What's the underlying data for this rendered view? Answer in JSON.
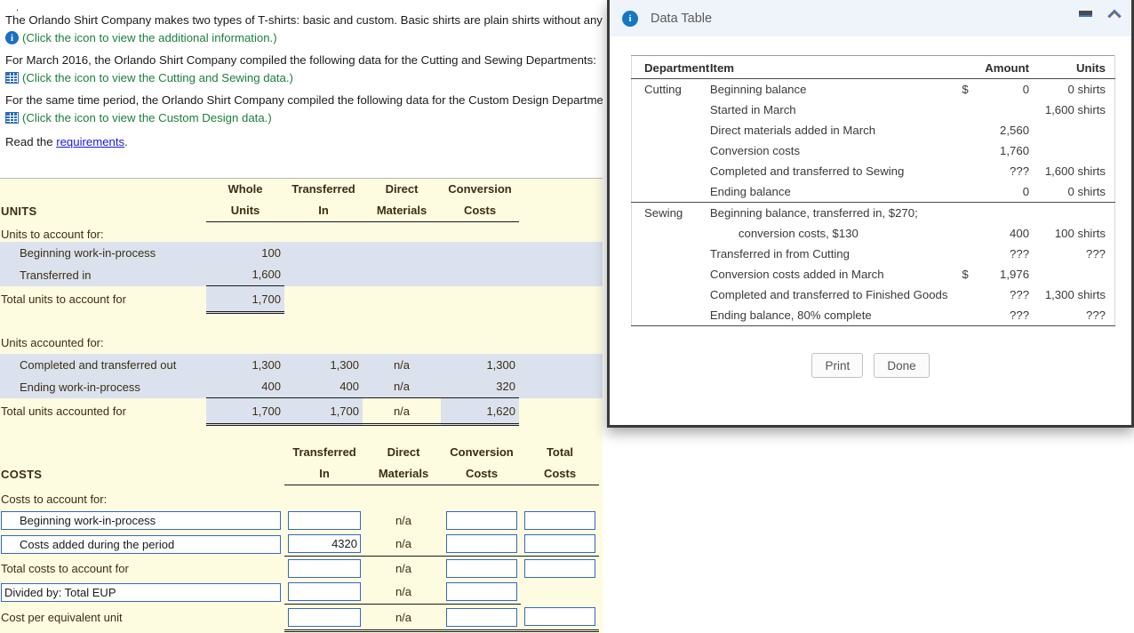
{
  "stray_char": ".",
  "prompt": {
    "intro": "The Orlando Shirt Company makes two types of T-shirts: basic and custom. Basic shirts are plain shirts without any",
    "info_caption": "(Click the icon to view the additional information.)",
    "line2": "For March 2016, the Orlando Shirt Company compiled the following data for the Cutting and Sewing Departments:",
    "line2_caption": "(Click the icon to view the Cutting and Sewing data.)",
    "line3": "For the same time period, the Orlando Shirt Company compiled the following data for the Custom Design Department",
    "line3_caption": "(Click the icon to view the Custom Design data.)",
    "read_prefix": "Read the ",
    "read_link": "requirements",
    "read_suffix": "."
  },
  "units_section": {
    "title": "UNITS",
    "headers": [
      {
        "top": "Whole",
        "bottom": "Units"
      },
      {
        "top": "Transferred",
        "bottom": "In"
      },
      {
        "top": "Direct",
        "bottom": "Materials"
      },
      {
        "top": "Conversion",
        "bottom": "Costs"
      }
    ],
    "to_account_header": "Units to account for:",
    "to_account_rows": [
      {
        "label": "Beginning work-in-process",
        "whole": "100",
        "transferred": "",
        "materials": "",
        "conversion": ""
      },
      {
        "label": "Transferred in",
        "whole": "1,600",
        "transferred": "",
        "materials": "",
        "conversion": ""
      }
    ],
    "to_account_total": {
      "label": "Total units to account for",
      "whole": "1,700",
      "transferred": "",
      "materials": "",
      "conversion": ""
    },
    "accounted_header": "Units accounted for:",
    "accounted_rows": [
      {
        "label": "Completed and transferred out",
        "whole": "1,300",
        "transferred": "1,300",
        "materials": "n/a",
        "conversion": "1,300"
      },
      {
        "label": "Ending work-in-process",
        "whole": "400",
        "transferred": "400",
        "materials": "n/a",
        "conversion": "320"
      }
    ],
    "accounted_total": {
      "label": "Total units accounted for",
      "whole": "1,700",
      "transferred": "1,700",
      "materials": "n/a",
      "conversion": "1,620"
    }
  },
  "costs_section": {
    "title": "COSTS",
    "headers": [
      {
        "top": "Transferred",
        "bottom": "In"
      },
      {
        "top": "Direct",
        "bottom": "Materials"
      },
      {
        "top": "Conversion",
        "bottom": "Costs"
      },
      {
        "top": "Total",
        "bottom": "Costs"
      }
    ],
    "to_account_header": "Costs to account for:",
    "rows": [
      {
        "label": "Beginning work-in-process",
        "label_boxed": true,
        "transferred": "",
        "materials": "n/a",
        "conversion": "",
        "total": ""
      },
      {
        "label": "Costs added during the period",
        "label_boxed": true,
        "transferred": "4320",
        "materials": "n/a",
        "conversion": "",
        "total": ""
      },
      {
        "label": "Total costs to account for",
        "label_boxed": false,
        "transferred": "",
        "materials": "n/a",
        "conversion": "",
        "total": ""
      },
      {
        "label": "Divided by: Total EUP",
        "label_boxed": true,
        "transferred": "",
        "materials": "n/a",
        "conversion": "",
        "total": null
      },
      {
        "label": "Cost per equivalent unit",
        "label_boxed": false,
        "transferred": "",
        "materials": "n/a",
        "conversion": "",
        "total": ""
      }
    ]
  },
  "dialog": {
    "badge": "i",
    "title": "Data Table",
    "minimize_icon": "minimize-icon",
    "expand_icon": "chevron-up-icon",
    "table": {
      "columns": [
        "Department",
        "Item",
        "Amount",
        "Units"
      ],
      "rows": [
        {
          "dept": "Cutting",
          "item": "Beginning balance",
          "currency": "$",
          "amount": "0",
          "units": "0 shirts"
        },
        {
          "dept": "",
          "item": "Started in March",
          "currency": "",
          "amount": "",
          "units": "1,600 shirts"
        },
        {
          "dept": "",
          "item": "Direct materials added in March",
          "currency": "",
          "amount": "2,560",
          "units": ""
        },
        {
          "dept": "",
          "item": "Conversion costs",
          "currency": "",
          "amount": "1,760",
          "units": ""
        },
        {
          "dept": "",
          "item": "Completed and transferred to Sewing",
          "currency": "",
          "amount": "???",
          "units": "1,600 shirts"
        },
        {
          "dept": "",
          "item": "Ending balance",
          "currency": "",
          "amount": "0",
          "units": "0 shirts"
        },
        {
          "dept": "Sewing",
          "item": "Beginning balance, transferred in, $270;",
          "currency": "",
          "amount": "",
          "units": ""
        },
        {
          "dept": "",
          "item": "conversion costs, $130",
          "indent": true,
          "currency": "",
          "amount": "400",
          "units": "100 shirts"
        },
        {
          "dept": "",
          "item": "Transferred in from Cutting",
          "currency": "",
          "amount": "???",
          "units": "???"
        },
        {
          "dept": "",
          "item": "Conversion costs added in March",
          "currency": "$",
          "amount": "1,976",
          "units": ""
        },
        {
          "dept": "",
          "item": "Completed and transferred to Finished Goods",
          "currency": "",
          "amount": "???",
          "units": "1,300 shirts"
        },
        {
          "dept": "",
          "item": "Ending balance, 80% complete",
          "currency": "",
          "amount": "???",
          "units": "???"
        }
      ],
      "section_break_index": 6
    },
    "buttons": {
      "print": "Print",
      "done": "Done"
    }
  },
  "colors": {
    "worksheet_bg": "#fdfbe0",
    "highlight_row": "#dbe2ee",
    "link": "#1a1ae0",
    "caption_green": "#1b7f3b",
    "accent_blue": "#1677c4",
    "input_border": "#3366cc"
  }
}
